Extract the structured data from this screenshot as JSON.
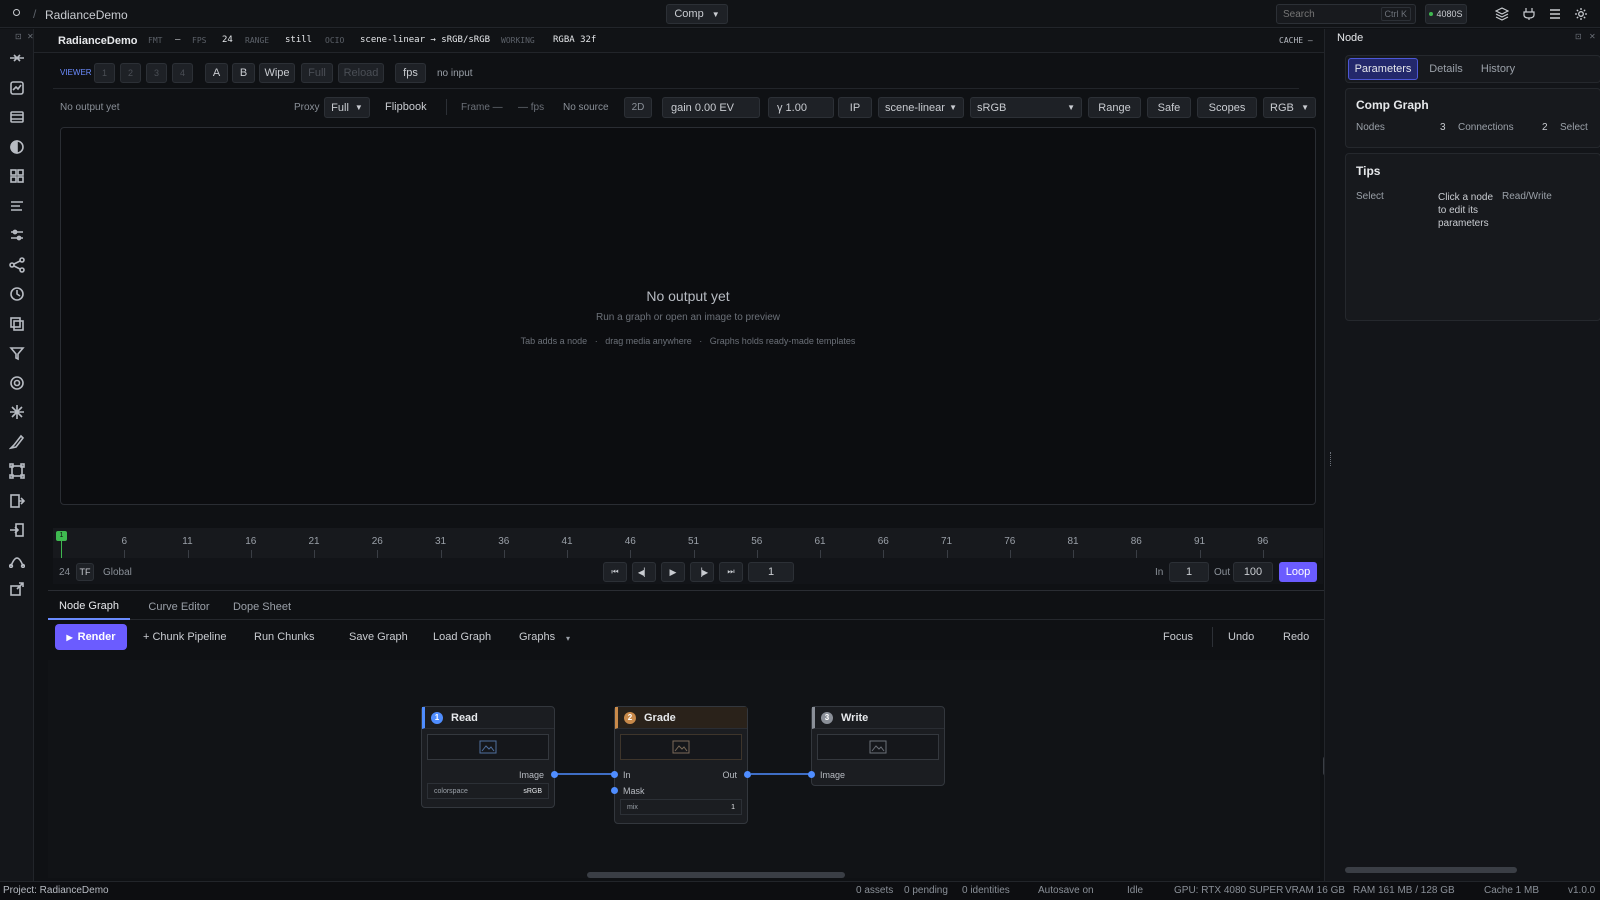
{
  "topbar": {
    "breadcrumb_sep": "/",
    "project": "RadianceDemo",
    "workspace": "Comp",
    "search_placeholder": "Search",
    "search_shortcut": "Ctrl K",
    "gpu_badge": "4080S"
  },
  "infobar": {
    "name": "RadianceDemo",
    "fmt_label": "FMT",
    "fmt_value": "–",
    "fps_label": "FPS",
    "fps_value": "24",
    "range_label": "RANGE",
    "range_value": "still",
    "ocio_label": "OCIO",
    "ocio_value": "scene-linear → sRGB/sRGB",
    "working_label": "WORKING",
    "working_value": "RGBA 32f",
    "cache_label": "CACHE –"
  },
  "viewer_toolbar": {
    "label": "VIEWER",
    "slots": [
      "1",
      "2",
      "3",
      "4"
    ],
    "a": "A",
    "b": "B",
    "wipe": "Wipe",
    "full": "Full",
    "reload": "Reload",
    "fps": "fps",
    "status": "no input"
  },
  "viewer_opts": {
    "status": "No output yet",
    "proxy_label": "Proxy",
    "proxy_value": "Full",
    "flipbook": "Flipbook",
    "frame": "Frame —",
    "fps": "— fps",
    "source": "No source",
    "mode": "2D",
    "gain": "gain 0.00 EV",
    "gamma": "γ 1.00",
    "ip": "IP",
    "input_space": "scene-linear",
    "display": "sRGB",
    "range": "Range",
    "safe": "Safe",
    "scopes": "Scopes",
    "channels": "RGB"
  },
  "viewport": {
    "title": "No output yet",
    "subtitle": "Run a graph or open an image to preview",
    "hint1": "Tab adds a node",
    "hint_sep": "·",
    "hint2": "drag media anywhere",
    "hint3": "Graphs holds ready-made templates"
  },
  "timeline": {
    "ticks": [
      "6",
      "11",
      "16",
      "21",
      "26",
      "31",
      "36",
      "41",
      "46",
      "51",
      "56",
      "61",
      "66",
      "71",
      "76",
      "81",
      "86",
      "91",
      "96"
    ],
    "playhead": "1",
    "fps": "24",
    "tf": "TF",
    "global": "Global",
    "frame": "1",
    "in_label": "In",
    "in_value": "1",
    "out_label": "Out",
    "out_value": "100",
    "loop": "Loop"
  },
  "bottom_tabs": [
    "Node Graph",
    "Curve Editor",
    "Dope Sheet"
  ],
  "graph_toolbar": {
    "render": "Render",
    "chunk": "+ Chunk Pipeline",
    "run_chunks": "Run Chunks",
    "save": "Save Graph",
    "load": "Load Graph",
    "graphs": "Graphs",
    "focus": "Focus",
    "undo": "Undo",
    "redo": "Redo"
  },
  "nodes": {
    "read": {
      "num": "1",
      "title": "Read",
      "out_port": "Image",
      "param_name": "colorspace",
      "param_value": "sRGB",
      "color": "#4f8dff"
    },
    "grade": {
      "num": "2",
      "title": "Grade",
      "in_port": "In",
      "mask_port": "Mask",
      "out_port": "Out",
      "param_name": "mix",
      "param_value": "1",
      "color": "#c98a4a"
    },
    "write": {
      "num": "3",
      "title": "Write",
      "in_port": "Image",
      "color": "#8a8f98"
    }
  },
  "right_panel": {
    "title": "Node",
    "tabs": [
      "Parameters",
      "Details",
      "History"
    ],
    "comp_title": "Comp Graph",
    "nodes_label": "Nodes",
    "nodes_value": "3",
    "connections_label": "Connections",
    "connections_value": "2",
    "select_label": "Select",
    "tips_title": "Tips",
    "tip1_key": "Select",
    "tip1_value": "Click a node to edit its parameters",
    "tip2_key": "Read/Write"
  },
  "status": {
    "project": "Project: RadianceDemo",
    "assets": "0 assets",
    "pending": "0 pending",
    "identities": "0 identities",
    "autosave": "Autosave on",
    "idle": "Idle",
    "gpu": "GPU: RTX 4080 SUPER",
    "vram": "VRAM 16 GB",
    "ram": "RAM 161 MB / 128 GB",
    "cache": "Cache 1 MB",
    "version": "v1.0.0"
  },
  "colors": {
    "accent": "#6b5cff",
    "port": "#4f8dff",
    "green": "#3fb950"
  }
}
